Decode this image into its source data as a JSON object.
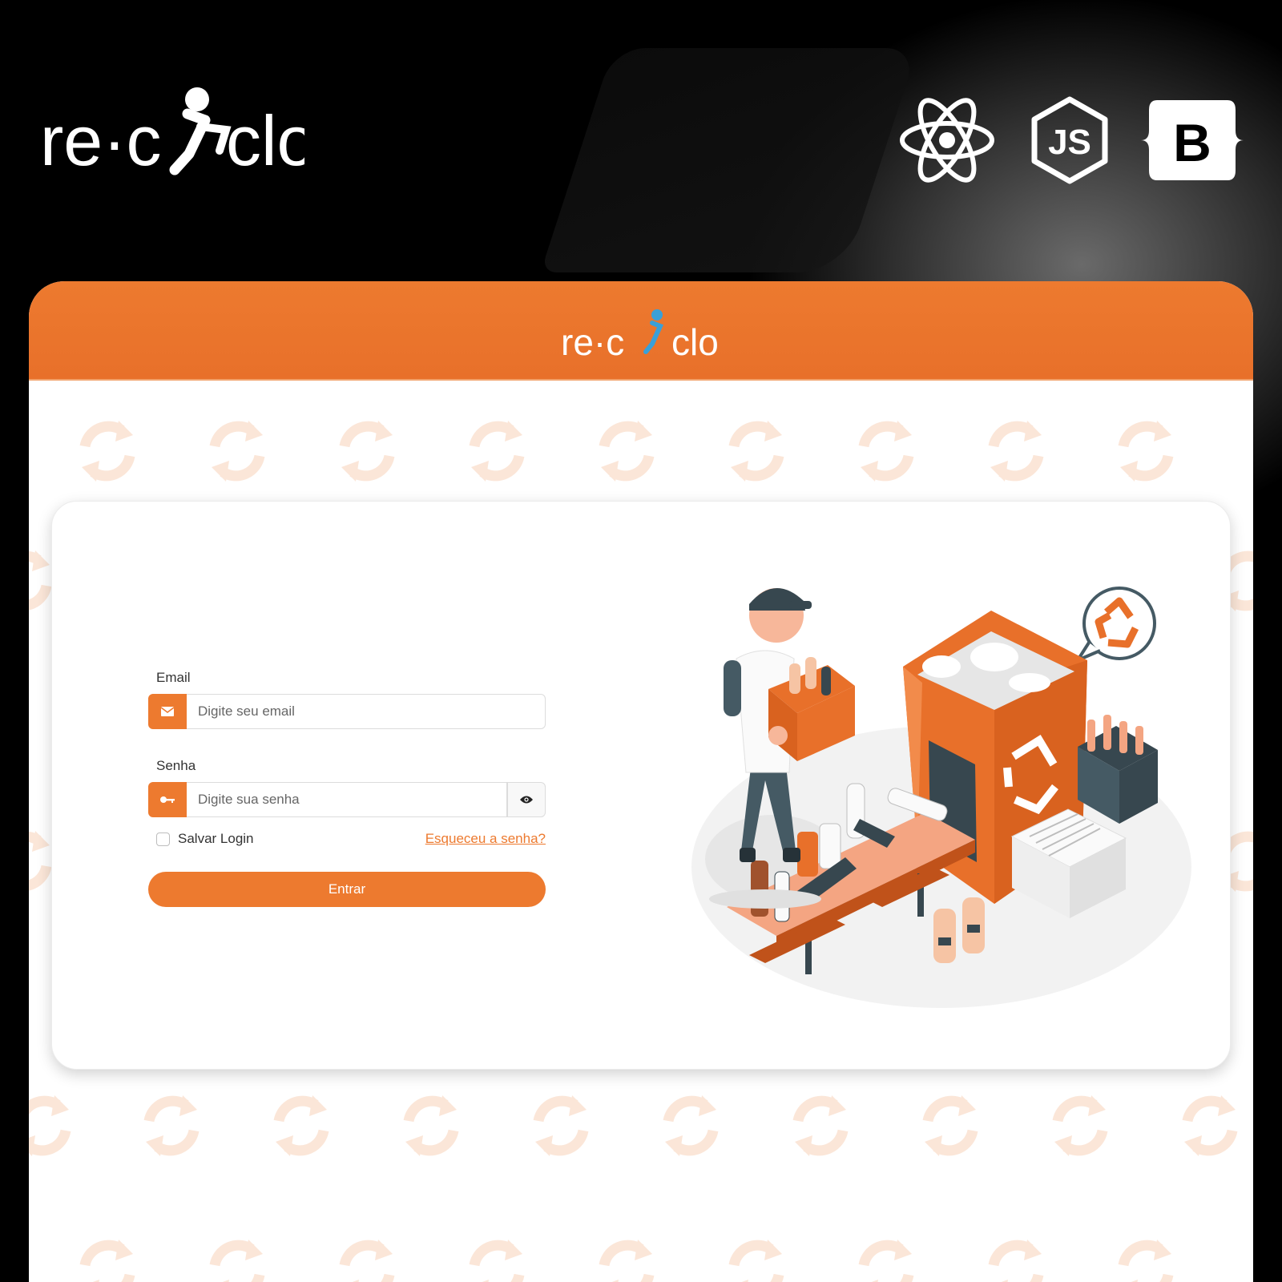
{
  "brand": {
    "logo_prefix": "re·c",
    "logo_suffix": "clo"
  },
  "tech_stack": [
    "react-icon",
    "nodejs-icon",
    "bootstrap-icon"
  ],
  "tech_bootstrap_letter": "B",
  "tech_node_letters": "JS",
  "colors": {
    "accent": "#ed7a2f",
    "header_logo_figure": "#3aa0d8",
    "dark": "#000000"
  },
  "form": {
    "email_label": "Email",
    "email_placeholder": "Digite seu email",
    "password_label": "Senha",
    "password_placeholder": "Digite sua senha",
    "remember_label": "Salvar Login",
    "forgot_label": "Esqueceu a senha?",
    "submit_label": "Entrar"
  },
  "icons": {
    "email": "envelope-icon",
    "password": "key-icon",
    "toggle": "eye-icon",
    "pattern": "refresh-arrows-icon"
  }
}
